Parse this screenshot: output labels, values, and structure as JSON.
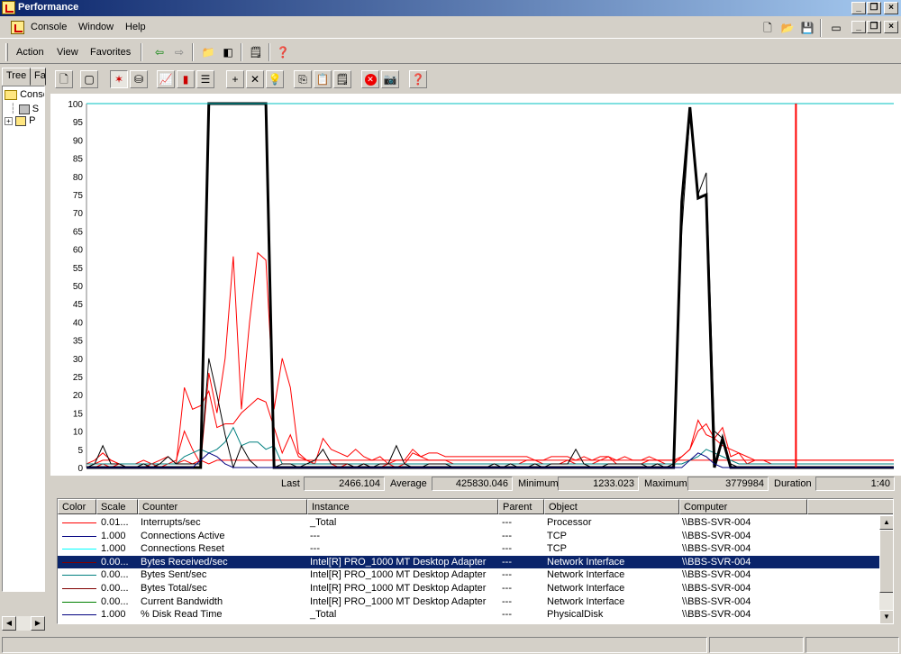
{
  "window": {
    "title": "Performance"
  },
  "menubar": {
    "items": [
      "Console",
      "Window",
      "Help"
    ]
  },
  "actionbar": {
    "items": [
      "Action",
      "View",
      "Favorites"
    ]
  },
  "tree": {
    "tabs": [
      "Tree",
      "Fa"
    ],
    "rows": [
      {
        "label": "Conso",
        "icon": "folder-icon"
      },
      {
        "label": "S",
        "icon": "system-monitor-icon"
      },
      {
        "label": "P",
        "icon": "logs-alerts-icon"
      }
    ]
  },
  "chart_data": {
    "type": "line",
    "ylim": [
      0,
      100
    ],
    "yticks": [
      "100",
      "95",
      "90",
      "85",
      "80",
      "75",
      "70",
      "65",
      "60",
      "55",
      "50",
      "45",
      "40",
      "35",
      "30",
      "25",
      "20",
      "15",
      "10",
      "5",
      "0"
    ],
    "x": [
      0,
      1,
      2,
      3,
      4,
      5,
      6,
      7,
      8,
      9,
      10,
      11,
      12,
      13,
      14,
      15,
      16,
      17,
      18,
      19,
      20,
      21,
      22,
      23,
      24,
      25,
      26,
      27,
      28,
      29,
      30,
      31,
      32,
      33,
      34,
      35,
      36,
      37,
      38,
      39,
      40,
      41,
      42,
      43,
      44,
      45,
      46,
      47,
      48,
      49,
      50,
      51,
      52,
      53,
      54,
      55,
      56,
      57,
      58,
      59,
      60,
      61,
      62,
      63,
      64,
      65,
      66,
      67,
      68,
      69,
      70,
      71,
      72,
      73,
      74,
      75,
      76,
      77,
      78,
      79,
      80,
      81,
      82,
      83,
      84,
      85,
      86,
      87,
      88,
      89,
      90,
      91,
      92,
      93,
      94,
      95,
      96,
      97,
      98,
      99
    ],
    "current_time_index": 87,
    "series": [
      {
        "name": "Interrupts/sec",
        "color": "#ff0000",
        "width": 1,
        "values": [
          1,
          1,
          2,
          2,
          1,
          1,
          1,
          2,
          1,
          2,
          3,
          1,
          2,
          1,
          2,
          1,
          2,
          2,
          2,
          2,
          2,
          2,
          2,
          2,
          2,
          2,
          2,
          2,
          2,
          2,
          2,
          2,
          2,
          2,
          2,
          2,
          2,
          2,
          2,
          2,
          2,
          2,
          2,
          2,
          2,
          2,
          2,
          2,
          2,
          2,
          2,
          2,
          2,
          2,
          2,
          2,
          2,
          2,
          2,
          2,
          2,
          2,
          2,
          2,
          2,
          2,
          2,
          2,
          2,
          2,
          2,
          2,
          2,
          2,
          2,
          2,
          2,
          2,
          2,
          2,
          2,
          2,
          2,
          2,
          2,
          2,
          2,
          2,
          2,
          2,
          2,
          2,
          2,
          2,
          2,
          2,
          2,
          2,
          2,
          2
        ]
      },
      {
        "name": "Bytes Received/sec",
        "color": "#ff0000",
        "width": 1,
        "values": [
          0,
          0,
          1,
          0,
          1,
          0,
          0,
          0,
          1,
          0,
          1,
          2,
          10,
          5,
          1,
          26,
          15,
          30,
          58,
          16,
          40,
          59,
          57,
          16,
          30,
          22,
          4,
          2,
          1,
          1,
          1,
          0,
          1,
          0,
          1,
          0,
          0,
          1,
          0,
          1,
          4,
          3,
          2,
          2,
          2,
          1,
          1,
          1,
          1,
          1,
          1,
          1,
          1,
          1,
          2,
          2,
          1,
          1,
          1,
          2,
          1,
          1,
          1,
          2,
          3,
          1,
          1,
          1,
          1,
          2,
          2,
          1,
          1,
          3,
          5,
          10,
          12,
          8,
          11,
          3,
          4,
          1,
          2,
          2,
          1,
          1,
          1,
          1,
          1,
          1,
          1,
          1,
          1,
          1,
          1,
          1,
          1,
          1,
          1,
          1
        ]
      },
      {
        "name": "Bytes Sent/sec",
        "color": "#ff0000",
        "width": 1,
        "values": [
          1,
          2,
          4,
          2,
          1,
          1,
          1,
          1,
          1,
          1,
          1,
          1,
          22,
          16,
          17,
          21,
          11,
          12,
          12,
          15,
          17,
          19,
          18,
          11,
          4,
          9,
          3,
          2,
          1,
          8,
          5,
          4,
          3,
          5,
          3,
          2,
          3,
          1,
          2,
          2,
          5,
          3,
          4,
          4,
          3,
          3,
          3,
          3,
          3,
          3,
          3,
          3,
          3,
          3,
          3,
          2,
          2,
          3,
          3,
          3,
          2,
          3,
          2,
          3,
          3,
          2,
          3,
          2,
          2,
          3,
          2,
          2,
          2,
          3,
          5,
          13,
          9,
          8,
          6,
          5,
          4,
          3,
          2,
          2,
          2,
          2,
          2,
          2,
          2,
          2,
          2,
          2,
          2,
          2,
          2,
          2,
          2,
          2,
          2,
          2
        ]
      },
      {
        "name": "Connections Reset",
        "color": "#008080",
        "width": 1,
        "values": [
          1,
          1,
          1,
          1,
          1,
          1,
          1,
          1,
          1,
          1,
          1,
          1,
          3,
          4,
          5,
          4,
          5,
          7,
          11,
          6,
          7,
          7,
          5,
          6,
          1,
          1,
          1,
          1,
          1,
          1,
          1,
          1,
          1,
          1,
          1,
          1,
          1,
          1,
          1,
          1,
          1,
          1,
          1,
          1,
          1,
          1,
          1,
          1,
          1,
          1,
          1,
          1,
          1,
          1,
          1,
          1,
          1,
          1,
          1,
          1,
          1,
          1,
          1,
          1,
          1,
          1,
          1,
          1,
          1,
          1,
          1,
          1,
          1,
          1,
          2,
          3,
          5,
          4,
          3,
          2,
          1,
          1,
          1,
          1,
          1,
          1,
          1,
          1,
          1,
          1,
          1,
          1,
          1,
          1,
          1,
          1,
          1,
          1,
          1,
          1
        ]
      },
      {
        "name": "Bytes Total/sec",
        "color": "#000000",
        "width": 1,
        "values": [
          0,
          1,
          6,
          1,
          1,
          0,
          0,
          1,
          0,
          1,
          3,
          1,
          1,
          1,
          1,
          30,
          20,
          9,
          0,
          6,
          2,
          0,
          0,
          0,
          1,
          1,
          0,
          1,
          2,
          5,
          1,
          1,
          1,
          0,
          1,
          0,
          1,
          1,
          6,
          1,
          0,
          0,
          1,
          1,
          1,
          0,
          0,
          0,
          0,
          0,
          1,
          0,
          1,
          0,
          0,
          1,
          0,
          1,
          1,
          1,
          5,
          1,
          0,
          0,
          1,
          1,
          1,
          1,
          1,
          0,
          1,
          0,
          1,
          65,
          97,
          75,
          81,
          10,
          8,
          1,
          0,
          0,
          0,
          0,
          0,
          0,
          0,
          0,
          0,
          0,
          0,
          0,
          0,
          0,
          0,
          0,
          0,
          0,
          0,
          0
        ]
      },
      {
        "name": "Current Bandwidth",
        "color": "#000000",
        "width": 3,
        "values": [
          0,
          0,
          0,
          0,
          0,
          0,
          0,
          0,
          0,
          0,
          0,
          0,
          0,
          0,
          0,
          100,
          100,
          100,
          100,
          100,
          100,
          100,
          100,
          0,
          0,
          0,
          0,
          0,
          0,
          0,
          0,
          0,
          0,
          0,
          0,
          0,
          0,
          0,
          0,
          0,
          0,
          0,
          0,
          0,
          0,
          0,
          0,
          0,
          0,
          0,
          0,
          0,
          0,
          0,
          0,
          0,
          0,
          0,
          0,
          0,
          0,
          0,
          0,
          0,
          0,
          0,
          0,
          0,
          0,
          0,
          0,
          0,
          0,
          73,
          99,
          74,
          75,
          0,
          8,
          0,
          0,
          0,
          0,
          0,
          0,
          0,
          0,
          0,
          0,
          0,
          0,
          0,
          0,
          0,
          0,
          0,
          0,
          0,
          0,
          0
        ]
      },
      {
        "name": "% Disk Read Time",
        "color": "#000080",
        "width": 1,
        "values": [
          0,
          0,
          0,
          0,
          0,
          0,
          0,
          0,
          0,
          0,
          0,
          0,
          0,
          0,
          2,
          4,
          3,
          1,
          0,
          0,
          0,
          0,
          0,
          0,
          0,
          0,
          0,
          0,
          0,
          0,
          0,
          0,
          0,
          0,
          0,
          0,
          0,
          0,
          0,
          0,
          0,
          0,
          0,
          0,
          0,
          0,
          0,
          0,
          0,
          0,
          0,
          0,
          0,
          0,
          0,
          0,
          0,
          0,
          0,
          0,
          0,
          0,
          0,
          0,
          0,
          0,
          0,
          0,
          0,
          0,
          0,
          0,
          0,
          0,
          2,
          4,
          3,
          1,
          0,
          0,
          0,
          0,
          0,
          0,
          0,
          0,
          0,
          0,
          0,
          0,
          0,
          0,
          0,
          0,
          0,
          0,
          0,
          0,
          0,
          0
        ]
      },
      {
        "name": "Connections Active",
        "color": "#00c0c0",
        "width": 1,
        "values": [
          100,
          100,
          100,
          100,
          100,
          100,
          100,
          100,
          100,
          100,
          100,
          100,
          100,
          100,
          100,
          100,
          100,
          100,
          100,
          100,
          100,
          100,
          100,
          100,
          100,
          100,
          100,
          100,
          100,
          100,
          100,
          100,
          100,
          100,
          100,
          100,
          100,
          100,
          100,
          100,
          100,
          100,
          100,
          100,
          100,
          100,
          100,
          100,
          100,
          100,
          100,
          100,
          100,
          100,
          100,
          100,
          100,
          100,
          100,
          100,
          100,
          100,
          100,
          100,
          100,
          100,
          100,
          100,
          100,
          100,
          100,
          100,
          100,
          100,
          100,
          100,
          100,
          100,
          100,
          100,
          100,
          100,
          100,
          100,
          100,
          100,
          100,
          100,
          100,
          100,
          100,
          100,
          100,
          100,
          100,
          100,
          100,
          100,
          100,
          100
        ]
      }
    ]
  },
  "stats": {
    "last_label": "Last",
    "last_value": "2466.104",
    "avg_label": "Average",
    "avg_value": "425830.046",
    "min_label": "Minimum",
    "min_value": "1233.023",
    "max_label": "Maximum",
    "max_value": "3779984",
    "dur_label": "Duration",
    "dur_value": "1:40"
  },
  "legend": {
    "headers": [
      "Color",
      "Scale",
      "Counter",
      "Instance",
      "Parent",
      "Object",
      "Computer"
    ],
    "rows": [
      {
        "color": "#ff0000",
        "scale": "0.01...",
        "counter": "Interrupts/sec",
        "instance": "_Total",
        "parent": "---",
        "object": "Processor",
        "computer": "\\\\BBS-SVR-004",
        "selected": false
      },
      {
        "color": "#000080",
        "scale": "1.000",
        "counter": "Connections Active",
        "instance": "---",
        "parent": "---",
        "object": "TCP",
        "computer": "\\\\BBS-SVR-004",
        "selected": false
      },
      {
        "color": "#00ffff",
        "scale": "1.000",
        "counter": "Connections Reset",
        "instance": "---",
        "parent": "---",
        "object": "TCP",
        "computer": "\\\\BBS-SVR-004",
        "selected": false
      },
      {
        "color": "#800000",
        "scale": "0.00...",
        "counter": "Bytes Received/sec",
        "instance": "Intel[R] PRO_1000 MT Desktop Adapter",
        "parent": "---",
        "object": "Network Interface",
        "computer": "\\\\BBS-SVR-004",
        "selected": true
      },
      {
        "color": "#008080",
        "scale": "0.00...",
        "counter": "Bytes Sent/sec",
        "instance": "Intel[R] PRO_1000 MT Desktop Adapter",
        "parent": "---",
        "object": "Network Interface",
        "computer": "\\\\BBS-SVR-004",
        "selected": false
      },
      {
        "color": "#800000",
        "scale": "0.00...",
        "counter": "Bytes Total/sec",
        "instance": "Intel[R] PRO_1000 MT Desktop Adapter",
        "parent": "---",
        "object": "Network Interface",
        "computer": "\\\\BBS-SVR-004",
        "selected": false
      },
      {
        "color": "#008000",
        "scale": "0.00...",
        "counter": "Current Bandwidth",
        "instance": "Intel[R] PRO_1000 MT Desktop Adapter",
        "parent": "---",
        "object": "Network Interface",
        "computer": "\\\\BBS-SVR-004",
        "selected": false
      },
      {
        "color": "#000080",
        "scale": "1.000",
        "counter": "% Disk Read Time",
        "instance": "_Total",
        "parent": "---",
        "object": "PhysicalDisk",
        "computer": "\\\\BBS-SVR-004",
        "selected": false
      }
    ]
  },
  "toolbar_icons": [
    "new-counter-set-icon",
    "clear-display-icon",
    "view-graph-icon",
    "view-histogram-icon",
    "view-report-icon",
    "view-current-activity-icon",
    "view-log-data-icon",
    "view-report-data-icon",
    "add-counter-icon",
    "delete-counter-icon",
    "highlight-icon",
    "copy-properties-icon",
    "paste-counter-list-icon",
    "properties-icon",
    "freeze-display-icon",
    "update-data-icon",
    "help-icon"
  ]
}
